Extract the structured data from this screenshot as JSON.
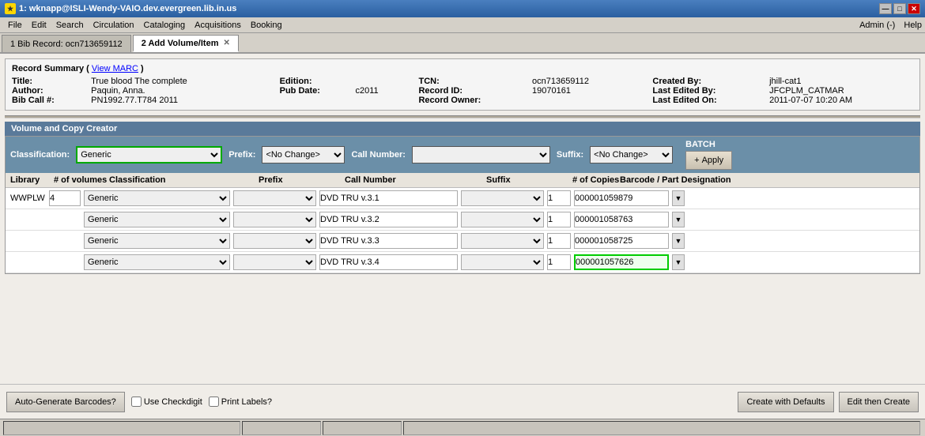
{
  "titlebar": {
    "title": "1: wknapp@ISLI-Wendy-VAIO.dev.evergreen.lib.in.us",
    "icon": "★",
    "min_btn": "—",
    "max_btn": "□",
    "close_btn": "✕"
  },
  "menubar": {
    "items": [
      {
        "label": "File",
        "id": "file"
      },
      {
        "label": "Edit",
        "id": "edit"
      },
      {
        "label": "Search",
        "id": "search"
      },
      {
        "label": "Circulation",
        "id": "circulation"
      },
      {
        "label": "Cataloging",
        "id": "cataloging"
      },
      {
        "label": "Acquisitions",
        "id": "acquisitions"
      },
      {
        "label": "Booking",
        "id": "booking"
      }
    ],
    "admin_label": "Admin (-)",
    "help_label": "Help"
  },
  "tabs": [
    {
      "label": "1 Bib Record: ocn713659112",
      "active": false
    },
    {
      "label": "2 Add Volume/Item",
      "active": true
    }
  ],
  "record_summary": {
    "header": "Record Summary  ( View MARC )",
    "view_marc_label": "View MARC",
    "fields": {
      "title_label": "Title:",
      "title_value": "True blood The complete",
      "edition_label": "Edition:",
      "edition_value": "",
      "tcn_label": "TCN:",
      "tcn_value": "ocn713659112",
      "created_by_label": "Created By:",
      "created_by_value": "jhill-cat1",
      "author_label": "Author:",
      "author_value": "Paquin, Anna.",
      "pub_date_label": "Pub Date:",
      "pub_date_value": "c2011",
      "record_id_label": "Record ID:",
      "record_id_value": "19070161",
      "last_edited_by_label": "Last Edited By:",
      "last_edited_by_value": "JFCPLM_CATMAR",
      "bib_call_label": "Bib Call #:",
      "bib_call_value": "PN1992.77.T784 2011",
      "record_owner_label": "Record Owner:",
      "record_owner_value": "",
      "last_edited_on_label": "Last Edited On:",
      "last_edited_on_value": "2011-07-07 10:20 AM"
    }
  },
  "volume_creator": {
    "section_label": "Volume and Copy Creator",
    "batch": {
      "classification_label": "Classification:",
      "classification_value": "Generic",
      "prefix_label": "Prefix:",
      "prefix_value": "<No Change>",
      "callnum_label": "Call Number:",
      "callnum_value": "",
      "suffix_label": "Suffix:",
      "suffix_value": "<No Change>",
      "batch_label": "BATCH",
      "apply_label": "Apply",
      "apply_icon": "+"
    },
    "column_headers": {
      "library": "Library",
      "volumes": "# of volumes",
      "classification": "Classification",
      "prefix": "Prefix",
      "callnum": "Call Number",
      "suffix": "Suffix",
      "copies": "# of Copies",
      "barcode": "Barcode / Part Designation"
    },
    "rows": [
      {
        "library": "WWPLW",
        "volumes": "4",
        "classification": "Generic",
        "prefix": "",
        "callnum": "DVD TRU v.3.1",
        "suffix": "",
        "copies": "1",
        "barcode": "000001059879",
        "barcode_active": false
      },
      {
        "library": "",
        "volumes": "",
        "classification": "Generic",
        "prefix": "",
        "callnum": "DVD TRU v.3.2",
        "suffix": "",
        "copies": "1",
        "barcode": "000001058763",
        "barcode_active": false
      },
      {
        "library": "",
        "volumes": "",
        "classification": "Generic",
        "prefix": "",
        "callnum": "DVD TRU v.3.3",
        "suffix": "",
        "copies": "1",
        "barcode": "000001058725",
        "barcode_active": false
      },
      {
        "library": "",
        "volumes": "",
        "classification": "Generic",
        "prefix": "",
        "callnum": "DVD TRU v.3.4",
        "suffix": "",
        "copies": "1",
        "barcode": "000001057626",
        "barcode_active": true
      }
    ]
  },
  "bottom_bar": {
    "auto_generate_label": "Auto-Generate Barcodes?",
    "use_checkdigit_label": "Use Checkdigit",
    "print_labels_label": "Print Labels?",
    "create_defaults_label": "Create with Defaults",
    "edit_create_label": "Edit then Create"
  }
}
